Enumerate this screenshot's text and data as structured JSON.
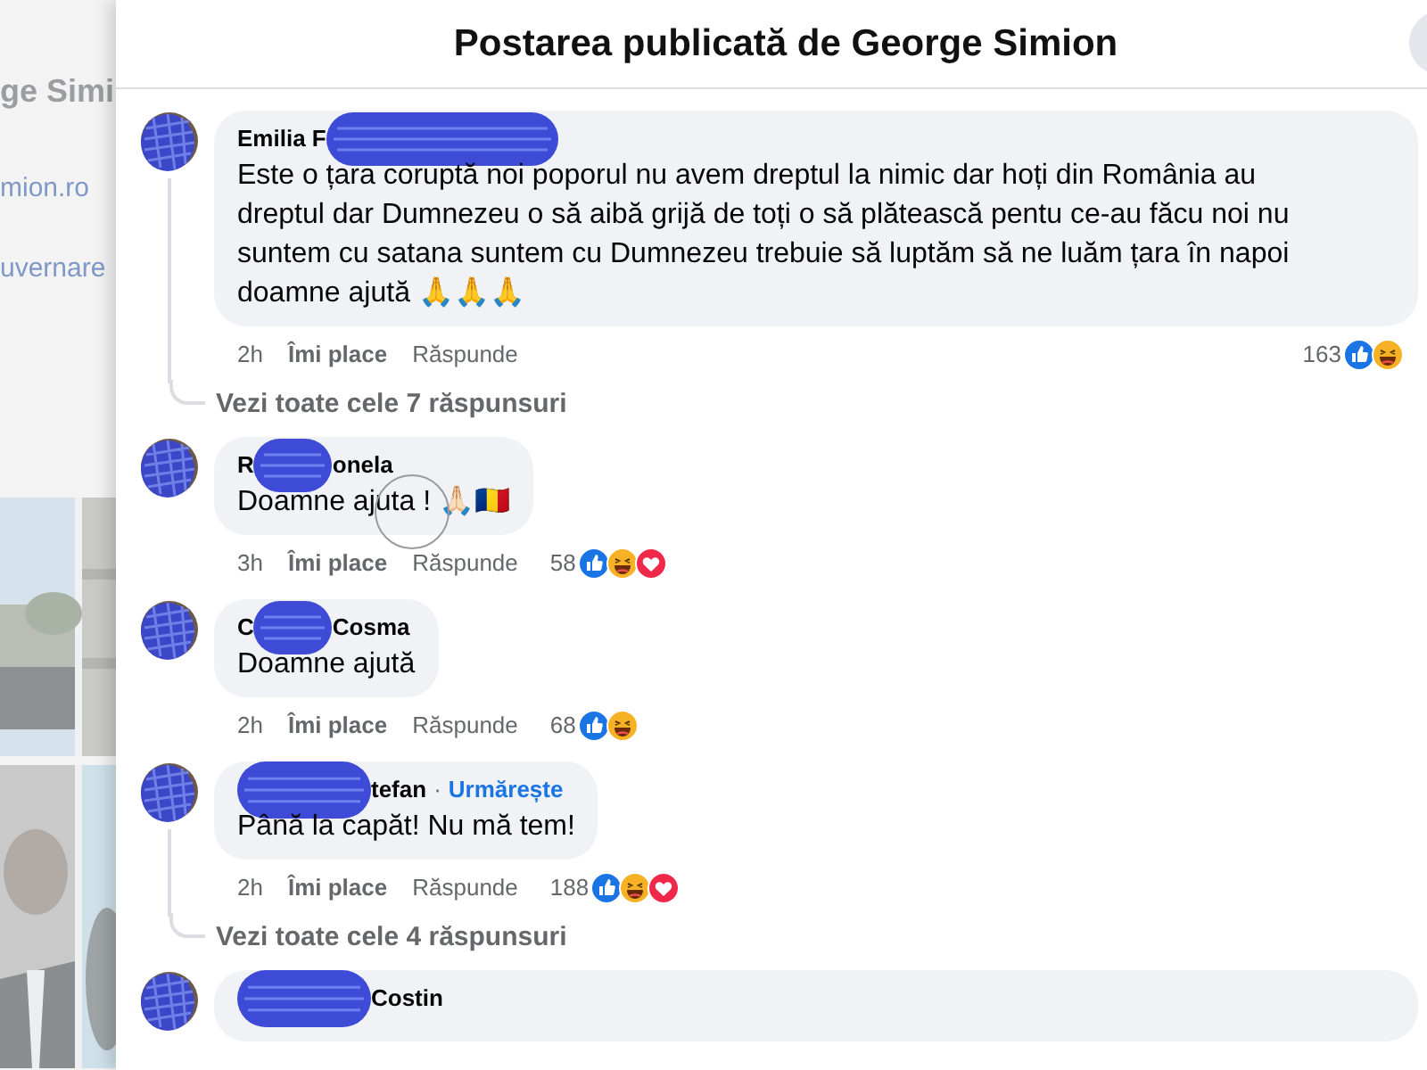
{
  "backdrop": {
    "texts": [
      {
        "kind": "title",
        "text": "ge Simi"
      },
      {
        "kind": "link",
        "text": "mion.ro"
      },
      {
        "kind": "link",
        "text": "uvernare"
      }
    ]
  },
  "dialog": {
    "title": "Postarea publicată de George Simion"
  },
  "comments": [
    {
      "kind": "long",
      "author": {
        "before": "Emilia F"
      },
      "text": "Este o țara coruptă noi poporul nu avem dreptul la nimic dar hoți din România au dreptul dar Dumnezeu o să aibă grijă de toți o să plătească pentu ce-au făcu noi nu suntem cu satana suntem cu Dumnezeu trebuie să luptăm să ne luăm țara în napoi doamne ajută 🙏🙏🙏",
      "time": "2h",
      "like": "Îmi place",
      "reply": "Răspunde",
      "count": "163",
      "reactions": {
        "like": true,
        "haha": true,
        "love": false
      },
      "replies_link": "Vezi toate cele 7 răspunsuri"
    },
    {
      "kind": "short",
      "author": {
        "before": "R",
        "after": "onela"
      },
      "text": "Doamne ajuta ! 🙏🏻🇷🇴",
      "time": "3h",
      "like": "Îmi place",
      "reply": "Răspunde",
      "count": "58",
      "reactions": {
        "like": true,
        "haha": true,
        "love": true
      },
      "cursor": true
    },
    {
      "kind": "short",
      "author": {
        "before": "C",
        "after": "Cosma"
      },
      "text": "Doamne ajută",
      "time": "2h",
      "like": "Îmi place",
      "reply": "Răspunde",
      "count": "68",
      "reactions": {
        "like": true,
        "haha": true,
        "love": false
      }
    },
    {
      "kind": "short",
      "author": {
        "after": "tefan"
      },
      "separator": "·",
      "follow": "Urmărește",
      "text": "Până la capăt! Nu mă tem!",
      "time": "2h",
      "like": "Îmi place",
      "reply": "Răspunde",
      "count": "188",
      "reactions": {
        "like": true,
        "haha": true,
        "love": true
      },
      "replies_link": "Vezi toate cele 4 răspunsuri"
    },
    {
      "kind": "long",
      "author": {
        "after": "Costin"
      }
    }
  ]
}
